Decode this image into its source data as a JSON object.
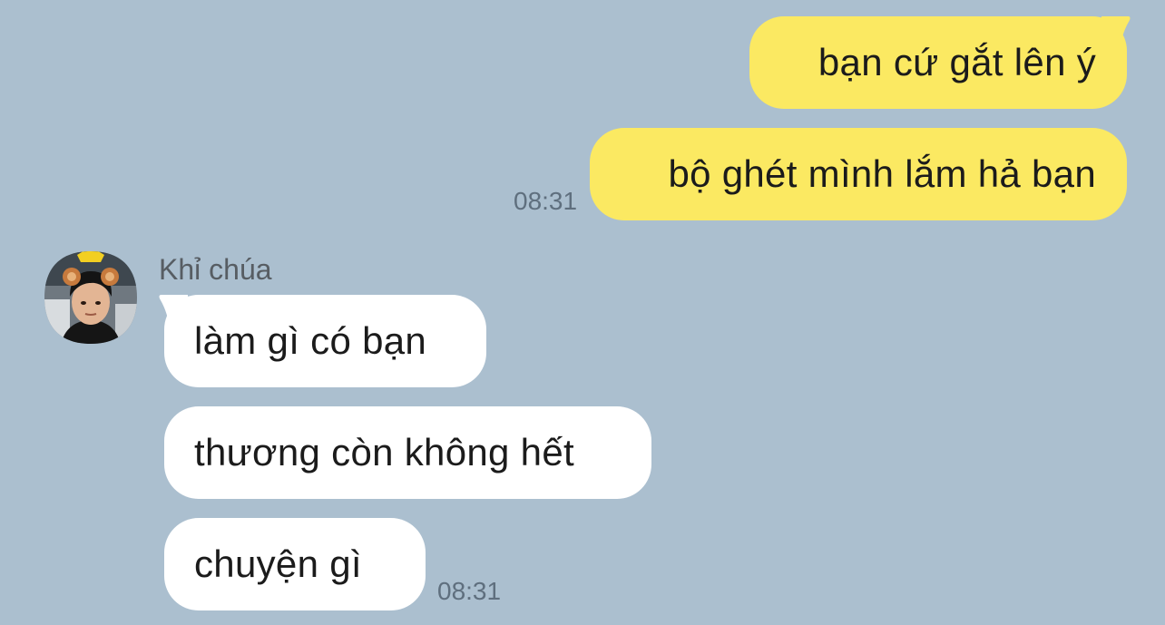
{
  "chat": {
    "outgoing": [
      {
        "text": "bạn cứ gắt lên ý"
      },
      {
        "text": "bộ ghét mình lắm hả bạn"
      }
    ],
    "outgoing_time": "08:31",
    "incoming": {
      "sender_name": "Khỉ chúa",
      "avatar_icon": "user-avatar-photo",
      "messages": [
        {
          "text": "làm gì có bạn"
        },
        {
          "text": "thương còn không hết"
        },
        {
          "text": "chuyện gì"
        }
      ],
      "time": "08:31"
    }
  },
  "colors": {
    "background": "#abbfcf",
    "outgoing_bubble": "#fbe962",
    "incoming_bubble": "#ffffff",
    "timestamp": "#5f6f7e",
    "sender_name": "#575d63"
  }
}
